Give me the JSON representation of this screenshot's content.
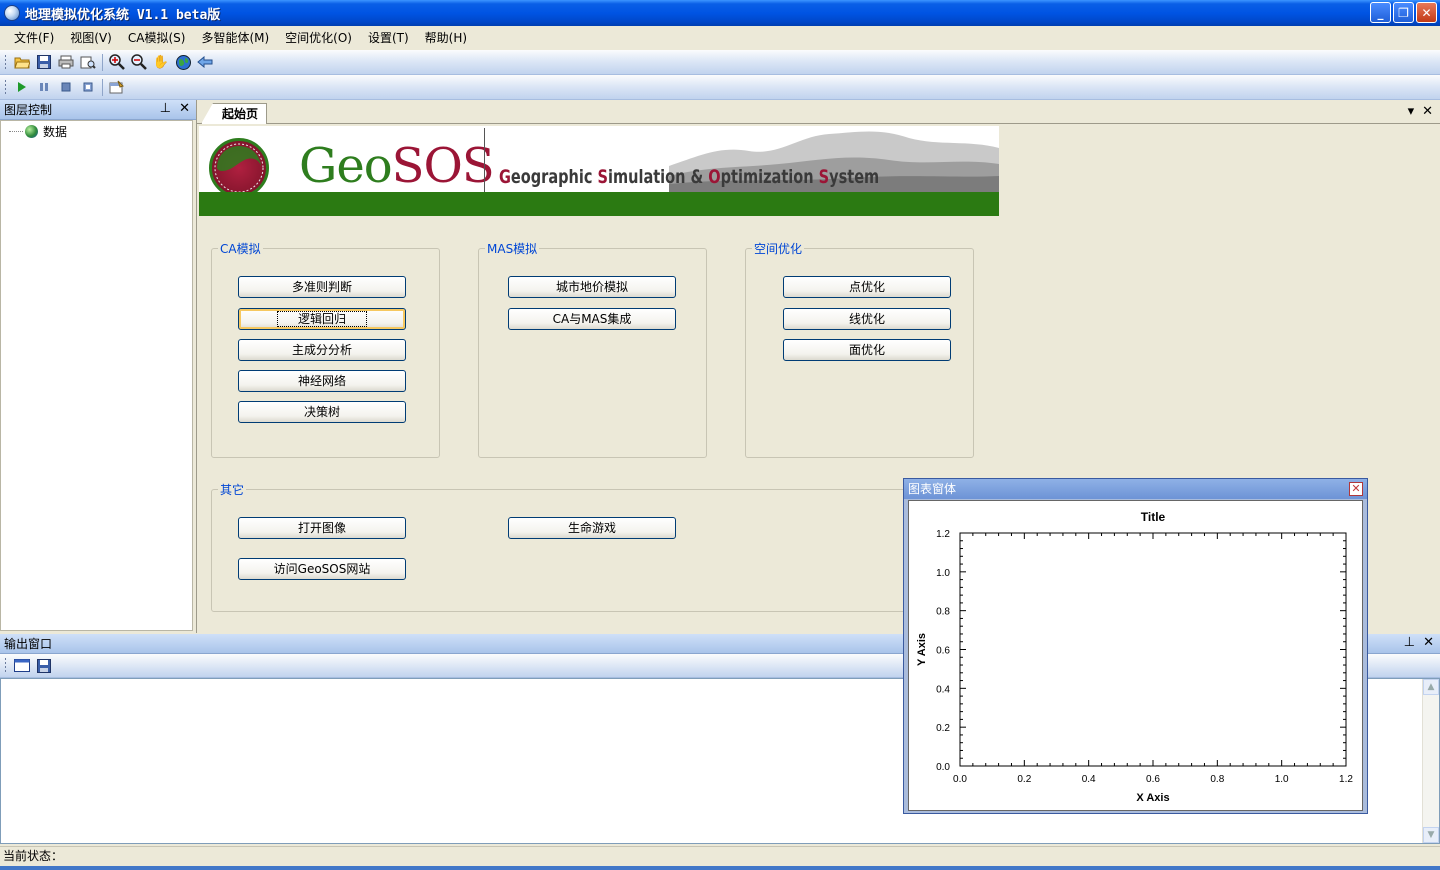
{
  "window": {
    "title": "地理模拟优化系统 V1.1 beta版"
  },
  "menu": [
    "文件(F)",
    "视图(V)",
    "CA模拟(S)",
    "多智能体(M)",
    "空间优化(O)",
    "设置(T)",
    "帮助(H)"
  ],
  "toolbar1": {
    "icons": [
      "open-folder-icon",
      "save-icon",
      "print-icon",
      "print-preview-icon",
      "zoom-in-icon",
      "zoom-out-icon",
      "pan-hand-icon",
      "full-extent-globe-icon",
      "back-arrow-icon"
    ]
  },
  "toolbar2": {
    "icons": [
      "play-icon",
      "pause-icon",
      "stop-icon",
      "step-icon",
      "properties-icon"
    ]
  },
  "layer_panel": {
    "title": "图层控制",
    "tree": [
      {
        "label": "数据",
        "icon": "globe-icon"
      }
    ]
  },
  "tabs": [
    {
      "label": "起始页",
      "active": true
    }
  ],
  "banner": {
    "logo_geo": "Geo",
    "logo_sos": "SOS",
    "tagline": [
      {
        "text": "G",
        "red": true
      },
      {
        "text": "eographic ",
        "red": false
      },
      {
        "text": "S",
        "red": true
      },
      {
        "text": "imulation & ",
        "red": false
      },
      {
        "text": "O",
        "red": true
      },
      {
        "text": "ptimization ",
        "red": false
      },
      {
        "text": "S",
        "red": true
      },
      {
        "text": "ystem",
        "red": false
      }
    ],
    "colors": {
      "green": "#2b7a12",
      "red": "#9b1536"
    }
  },
  "groups": {
    "ca": {
      "title": "CA模拟",
      "buttons": [
        "多准则判断",
        "逻辑回归",
        "主成分分析",
        "神经网络",
        "决策树"
      ]
    },
    "mas": {
      "title": "MAS模拟",
      "buttons": [
        "城市地价模拟",
        "CA与MAS集成"
      ]
    },
    "opt": {
      "title": "空间优化",
      "buttons": [
        "点优化",
        "线优化",
        "面优化"
      ]
    },
    "other": {
      "title": "其它",
      "buttons": [
        "打开图像",
        "生命游戏",
        "访问GeoSOS网站"
      ]
    }
  },
  "output_panel": {
    "title": "输出窗口",
    "icons": [
      "clear-icon",
      "save-icon"
    ]
  },
  "status": {
    "label": "当前状态：",
    "value": ""
  },
  "chart_window": {
    "title": "图表窗体"
  },
  "chart_data": {
    "type": "line",
    "title": "Title",
    "xlabel": "X Axis",
    "ylabel": "Y Axis",
    "xlim": [
      0,
      1.2
    ],
    "ylim": [
      0,
      1.2
    ],
    "xticks": [
      "0.0",
      "0.2",
      "0.4",
      "0.6",
      "0.8",
      "1.0",
      "1.2"
    ],
    "yticks": [
      "0.0",
      "0.2",
      "0.4",
      "0.6",
      "0.8",
      "1.0",
      "1.2"
    ],
    "series": [],
    "grid": false
  }
}
